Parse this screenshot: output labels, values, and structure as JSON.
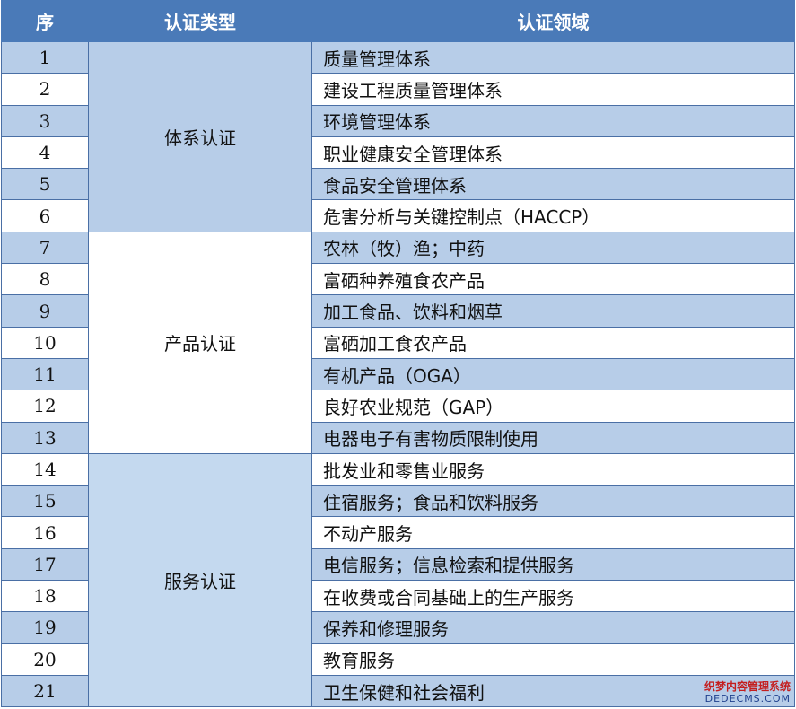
{
  "headers": {
    "num": "序",
    "type": "认证类型",
    "domain": "认证领域"
  },
  "groups": [
    {
      "name": "体系认证",
      "color": "#b7cde8",
      "rows": [
        {
          "num": "1",
          "domain": "质量管理体系"
        },
        {
          "num": "2",
          "domain": "建设工程质量管理体系"
        },
        {
          "num": "3",
          "domain": "环境管理体系"
        },
        {
          "num": "4",
          "domain": "职业健康安全管理体系"
        },
        {
          "num": "5",
          "domain": "食品安全管理体系"
        },
        {
          "num": "6",
          "domain": "危害分析与关键控制点（HACCP）"
        }
      ]
    },
    {
      "name": "产品认证",
      "color": "#ffffff",
      "rows": [
        {
          "num": "7",
          "domain": "农林（牧）渔；中药"
        },
        {
          "num": "8",
          "domain": "富硒种养殖食农产品"
        },
        {
          "num": "9",
          "domain": "加工食品、饮料和烟草"
        },
        {
          "num": "10",
          "domain": "富硒加工食农产品"
        },
        {
          "num": "11",
          "domain": "有机产品（OGA）"
        },
        {
          "num": "12",
          "domain": "良好农业规范（GAP）"
        },
        {
          "num": "13",
          "domain": "电器电子有害物质限制使用"
        }
      ]
    },
    {
      "name": "服务认证",
      "color": "#c4d9ef",
      "rows": [
        {
          "num": "14",
          "domain": "批发业和零售业服务"
        },
        {
          "num": "15",
          "domain": "住宿服务；食品和饮料服务"
        },
        {
          "num": "16",
          "domain": "不动产服务"
        },
        {
          "num": "17",
          "domain": "电信服务；信息检索和提供服务"
        },
        {
          "num": "18",
          "domain": "在收费或合同基础上的生产服务"
        },
        {
          "num": "19",
          "domain": "保养和修理服务"
        },
        {
          "num": "20",
          "domain": "教育服务"
        },
        {
          "num": "21",
          "domain": "卫生保健和社会福利"
        }
      ]
    }
  ],
  "watermark": {
    "line1": "织梦内容管理系统",
    "line2": "DEDECMS.COM"
  }
}
